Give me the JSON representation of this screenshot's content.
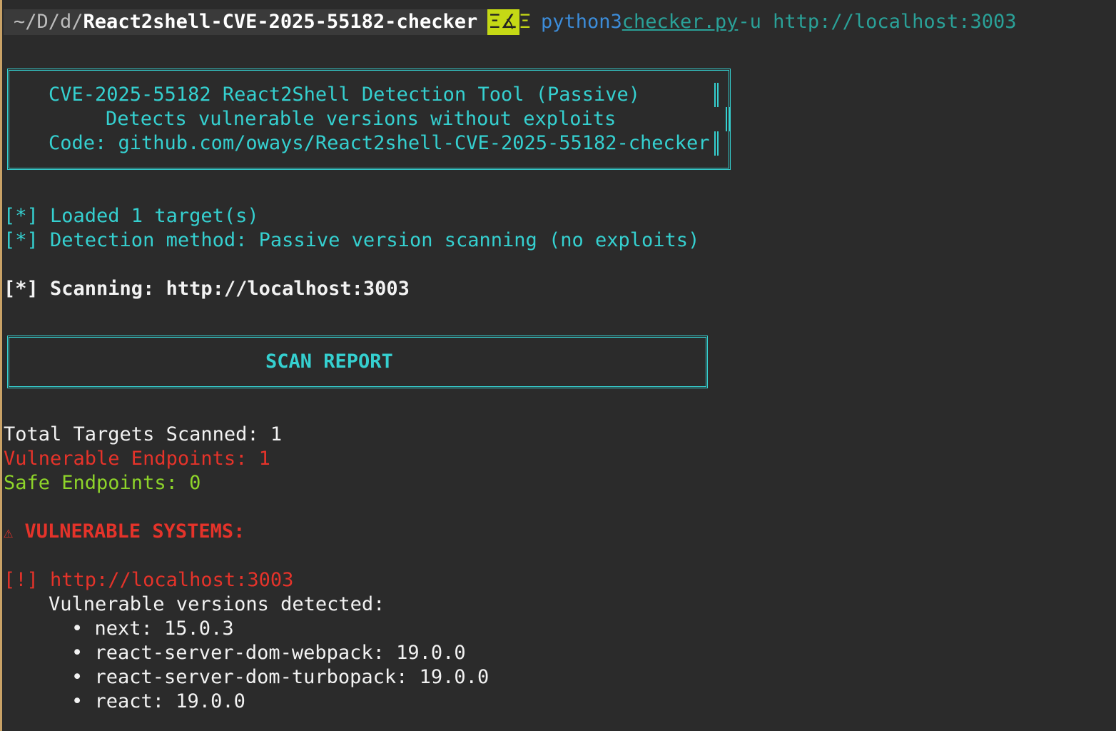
{
  "prompt": {
    "path_dim": "~/D/d/",
    "path_bold": "React2shell-CVE-2025-55182-checker",
    "git_icon_left": "Ξ",
    "git_icon_mid": "∡",
    "git_icon_right": "Ξ",
    "command": "python3",
    "file": "checker.py",
    "args": "-u http://localhost:3003"
  },
  "banner": {
    "line1": "CVE-2025-55182 React2Shell Detection Tool (Passive)",
    "line2": "Detects vulnerable versions without exploits",
    "line3": "Code: github.com/oways/React2shell-CVE-2025-55182-checker"
  },
  "info": {
    "loaded": "[*] Loaded 1 target(s)",
    "method": "[*] Detection method: Passive version scanning (no exploits)",
    "scanning": "[*] Scanning: http://localhost:3003"
  },
  "report": {
    "title": "SCAN REPORT",
    "total": "Total Targets Scanned: 1",
    "vulnerable": "Vulnerable Endpoints: 1",
    "safe": "Safe Endpoints: 0",
    "warning_icon": "⚠",
    "vuln_header": "VULNERABLE SYSTEMS:",
    "target": "[!] http://localhost:3003",
    "detected": "Vulnerable versions detected:",
    "packages": [
      "• next: 15.0.3",
      "• react-server-dom-webpack: 19.0.0",
      "• react-server-dom-turbopack: 19.0.0",
      "• react: 19.0.0"
    ]
  },
  "colors": {
    "background": "#2b2b2b",
    "cyan": "#35d0d0",
    "red": "#e5332a",
    "green": "#8ed42a",
    "git_segment": "#c5d915"
  }
}
